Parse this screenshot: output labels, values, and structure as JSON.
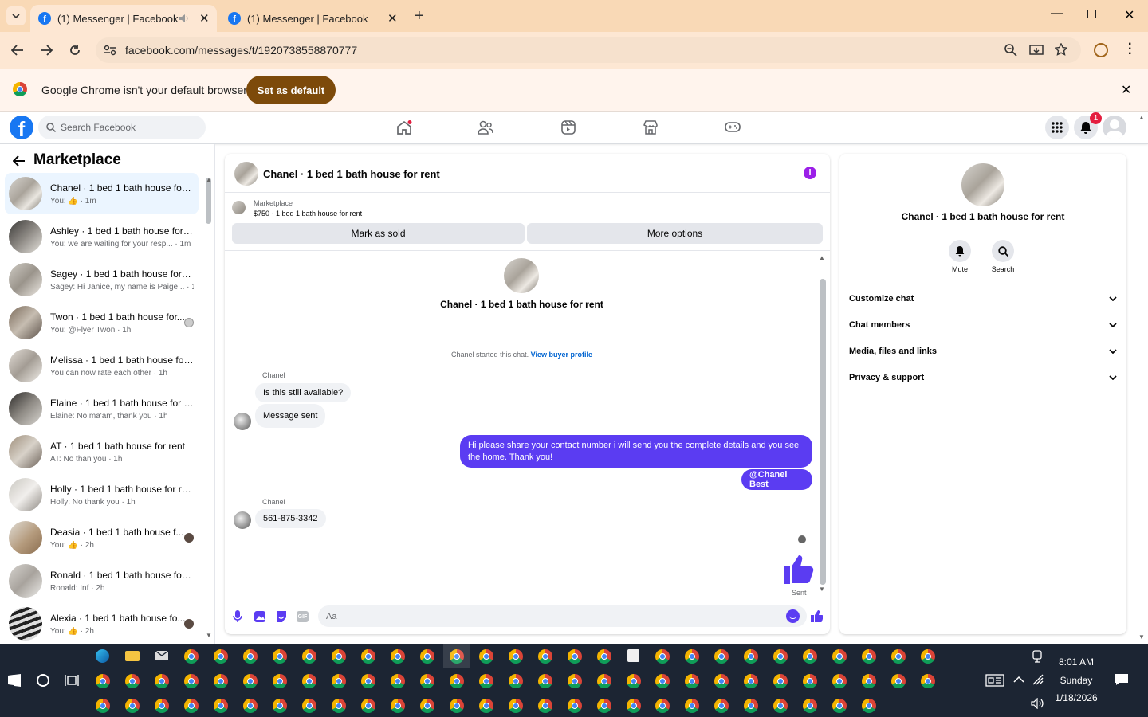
{
  "browser": {
    "tabs": [
      {
        "title": "(1) Messenger | Facebook",
        "active": true,
        "muted_icon": "speaker-icon"
      },
      {
        "title": "(1) Messenger | Facebook",
        "active": false
      }
    ],
    "url": "facebook.com/messages/t/1920738558870777",
    "infobar": {
      "message": "Google Chrome isn't your default browser",
      "button": "Set as default"
    }
  },
  "fb_header": {
    "search_placeholder": "Search Facebook",
    "notification_count": "1",
    "nav_icons": [
      "home-icon",
      "friends-icon",
      "video-icon",
      "marketplace-icon",
      "gaming-icon"
    ]
  },
  "sidebar": {
    "title": "Marketplace",
    "conversations": [
      {
        "name": "Chanel · 1 bed 1 bath house for ...",
        "preview": "You: 👍 · 1m",
        "selected": true
      },
      {
        "name": "Ashley · 1 bed 1 bath house for ...",
        "preview": "You: we are waiting for your resp... · 1m"
      },
      {
        "name": "Sagey · 1 bed 1 bath house for r...",
        "preview": "Sagey: Hi Janice, my name is Paige... · 1h"
      },
      {
        "name": "Twon · 1 bed 1 bath house for...",
        "preview": "You: @Flyer Twon · 1h"
      },
      {
        "name": "Melissa · 1 bed 1 bath house for...",
        "preview": "You can now rate each other · 1h"
      },
      {
        "name": "Elaine · 1 bed 1 bath house for r...",
        "preview": "Elaine: No ma'am, thank you · 1h"
      },
      {
        "name": "AT · 1 bed 1 bath house for rent",
        "preview": "AT: No than you · 1h"
      },
      {
        "name": "Holly · 1 bed 1 bath house for re...",
        "preview": "Holly: No thank you · 1h"
      },
      {
        "name": "Deasia · 1 bed 1 bath house f...",
        "preview": "You: 👍 · 2h"
      },
      {
        "name": "Ronald · 1 bed 1 bath house for ...",
        "preview": "Ronald: Inf · 2h"
      },
      {
        "name": "Alexia · 1 bed 1 bath house fo...",
        "preview": "You: 👍 · 2h"
      }
    ]
  },
  "chat": {
    "title": "Chanel · 1 bed 1 bath house for rent",
    "listing": {
      "source": "Marketplace",
      "summary": "$750 - 1 bed 1 bath house for rent"
    },
    "buttons": {
      "mark_sold": "Mark as sold",
      "more_options": "More options"
    },
    "intro_name": "Chanel · 1 bed 1 bath house for rent",
    "started_text": "Chanel started this chat.",
    "buyer_link": "View buyer profile",
    "messages": [
      {
        "sender": "Chanel",
        "text": "Is this still available?"
      },
      {
        "sender": "",
        "text": "Message sent"
      },
      {
        "sender": "me",
        "text": "Hi please share your contact number i will send you the complete details and you see the home. Thank you!"
      },
      {
        "sender": "me",
        "text": "@Chanel Best"
      },
      {
        "sender": "Chanel",
        "text": "561-875-3342"
      }
    ],
    "sent_label": "Sent",
    "composer_placeholder": "Aa"
  },
  "details": {
    "name": "Chanel · 1 bed 1 bath house for rent",
    "actions": [
      {
        "label": "Mute"
      },
      {
        "label": "Search"
      }
    ],
    "sections": [
      "Customize chat",
      "Chat members",
      "Media, files and links",
      "Privacy & support"
    ]
  },
  "taskbar": {
    "time": "8:01 AM",
    "day": "Sunday",
    "date": "1/18/2026"
  }
}
